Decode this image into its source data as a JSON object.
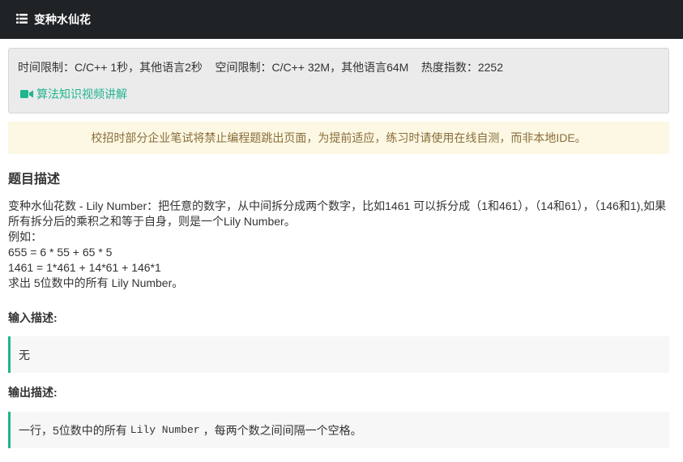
{
  "header": {
    "icon": "list-icon",
    "title": "变种水仙花"
  },
  "info": {
    "limits": "时间限制：C/C++ 1秒，其他语言2秒    空间限制：C/C++ 32M，其他语言64M    热度指数：2252",
    "video_link": {
      "icon": "video-camera-icon",
      "label": "算法知识视频讲解"
    },
    "accent_color": "#1fb58f"
  },
  "notice": "校招时部分企业笔试将禁止编程题跳出页面，为提前适应，练习时请使用在线自测，而非本地IDE。",
  "problem": {
    "title": "题目描述",
    "lines": [
      "变种水仙花数 - Lily Number：把任意的数字，从中间拆分成两个数字，比如1461 可以拆分成（1和461），（14和61），（146和1),如果所有拆分后的乘积之和等于自身，则是一个Lily Number。",
      "例如：",
      "655 = 6 * 55 + 65 * 5",
      "1461 = 1*461 + 14*61 + 146*1",
      "求出 5位数中的所有 Lily Number。"
    ]
  },
  "input": {
    "title": "输入描述:",
    "content": "无"
  },
  "output": {
    "title": "输出描述:",
    "prefix": "一行，5位数中的所有",
    "code": "Lily Number",
    "suffix": "，每两个数之间间隔一个空格。"
  }
}
